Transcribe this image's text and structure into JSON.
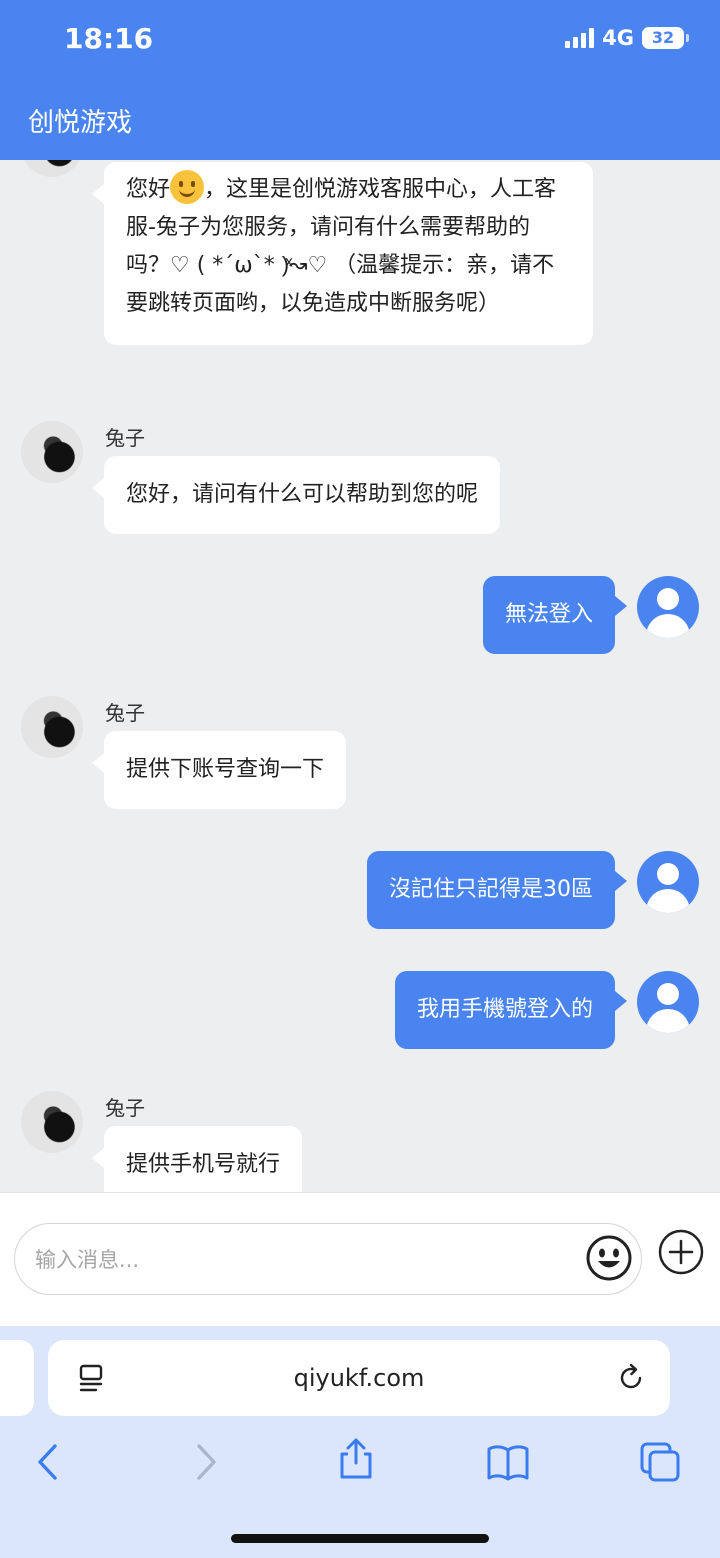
{
  "status_bar": {
    "time": "18:16",
    "network": "4G",
    "battery": "32"
  },
  "header": {
    "title": "创悦游戏"
  },
  "messages": [
    {
      "from": "agent",
      "name": "",
      "text_before": "您好",
      "emoji": "smiling-face-emoji",
      "text_after": "，这里是创悦游戏客服中心，人工客服-兔子为您服务，请问有什么需要帮助的吗？♡ ( *ˊωˋ* )ͯ↝♡ （温馨提示：亲，请不要跳转页面哟，以免造成中断服务呢）"
    },
    {
      "from": "agent",
      "name": "兔子",
      "text": "您好，请问有什么可以帮助到您的呢"
    },
    {
      "from": "user",
      "text": "無法登入"
    },
    {
      "from": "agent",
      "name": "兔子",
      "text": "提供下账号查询一下"
    },
    {
      "from": "user",
      "text": "沒記住只記得是30區"
    },
    {
      "from": "user",
      "text": "我用手機號登入的"
    },
    {
      "from": "agent",
      "name": "兔子",
      "text": "提供手机号就行"
    }
  ],
  "composer": {
    "placeholder": "输入消息...",
    "value": "",
    "emoji_icon": "emoji-icon",
    "plus_icon": "plus-circle-icon"
  },
  "browser": {
    "url": "qiyukf.com",
    "icons": [
      "page-menu-icon",
      "reload-icon",
      "back-icon",
      "forward-icon",
      "share-icon",
      "bookmarks-icon",
      "tabs-icon"
    ]
  },
  "colors": {
    "accent": "#4a84f0",
    "background": "#edeef0",
    "browser_bar": "#dbe6fa"
  }
}
